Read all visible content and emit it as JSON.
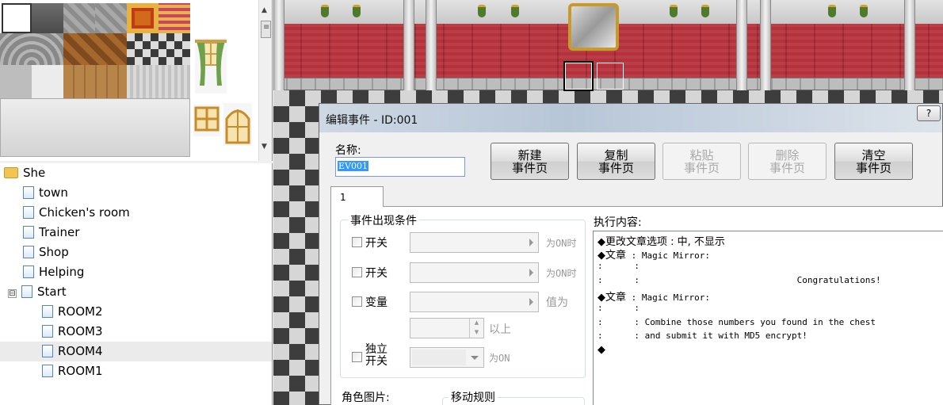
{
  "map_tree": {
    "items": [
      {
        "label": "She",
        "type": "folder"
      },
      {
        "label": "town",
        "type": "map"
      },
      {
        "label": "Chicken's room",
        "type": "map"
      },
      {
        "label": "Trainer",
        "type": "map"
      },
      {
        "label": "Shop",
        "type": "map"
      },
      {
        "label": "Helping",
        "type": "map"
      },
      {
        "label": "Start",
        "type": "map",
        "expander": "⊟"
      },
      {
        "label": "ROOM2",
        "type": "map"
      },
      {
        "label": "ROOM3",
        "type": "map"
      },
      {
        "label": "ROOM4",
        "type": "map",
        "selected": true
      },
      {
        "label": "ROOM1",
        "type": "map"
      }
    ]
  },
  "tileset": {
    "scroll_up": "▲",
    "scroll_down": "▼",
    "scroll_grip": "≡"
  },
  "dialog": {
    "title": "编辑事件 - ID:001",
    "help_label": "?",
    "name_label": "名称:",
    "name_value": "EV001",
    "buttons": {
      "new_page": [
        "新建",
        "事件页"
      ],
      "copy_page": [
        "复制",
        "事件页"
      ],
      "paste_page": [
        "粘贴",
        "事件页"
      ],
      "delete_page": [
        "删除",
        "事件页"
      ],
      "clear_page": [
        "清空",
        "事件页"
      ]
    },
    "tab_label": "1",
    "conditions": {
      "title": "事件出现条件",
      "switch1_label": "开关",
      "switch1_suffix": "为ON时",
      "switch2_label": "开关",
      "switch2_suffix": "为ON时",
      "variable_label": "变量",
      "variable_suffix": "值为",
      "above_suffix": "以上",
      "self_switch_line1": "独立",
      "self_switch_line2": "开关",
      "self_switch_suffix": "为ON"
    },
    "graphic_label": "角色图片:",
    "move_rule_label": "移动规则",
    "commands_label": "执行内容:",
    "commands": [
      {
        "prefix": "◆",
        "text_zh": "更改文章选项",
        "text": " : 中, 不显示"
      },
      {
        "prefix": "◆",
        "text_zh": "文章",
        "text": " : Magic Mirror:"
      },
      {
        "prefix": ":",
        "text_zh": "",
        "text": "      :"
      },
      {
        "prefix": ":",
        "text_zh": "",
        "text": "      :                              Congratulations!"
      },
      {
        "prefix": "◆",
        "text_zh": "文章",
        "text": " : Magic Mirror:"
      },
      {
        "prefix": ":",
        "text_zh": "",
        "text": "      :"
      },
      {
        "prefix": ":",
        "text_zh": "",
        "text": "      : Combine those numbers you found in the chest"
      },
      {
        "prefix": ":",
        "text_zh": "",
        "text": "      : and submit it with MD5 encrypt!"
      },
      {
        "prefix": "◆",
        "text_zh": "",
        "text": ""
      }
    ]
  },
  "colors": {
    "selection": "#3399ff",
    "carpet": "#b5323c",
    "title_bar": "#b7c6d7"
  }
}
